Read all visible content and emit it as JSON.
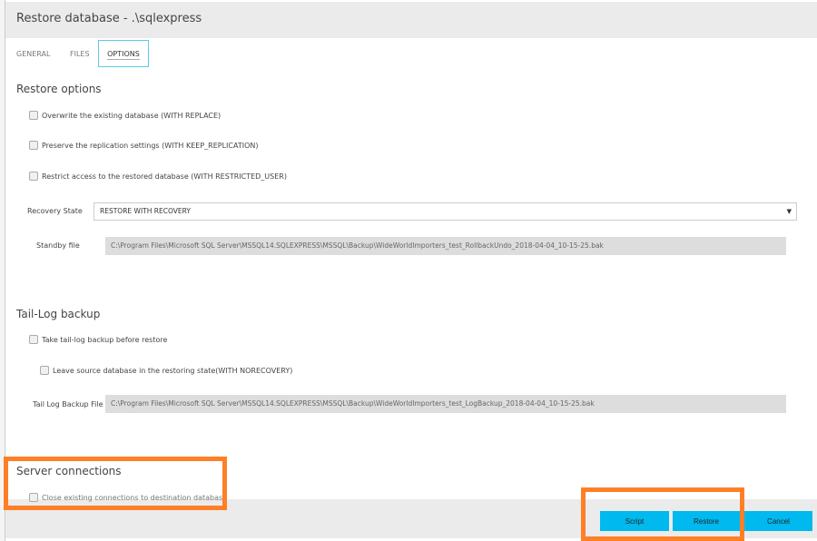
{
  "title": "Restore database - .\\sqlexpress",
  "tabs": [
    "GENERAL",
    "FILES",
    "OPTIONS"
  ],
  "restore_options": {
    "heading": "Restore options",
    "checkboxes": [
      "Overwrite the existing database (WITH REPLACE)",
      "Preserve the replication settings (WITH KEEP_REPLICATION)",
      "Restrict access to the restored database (WITH RESTRICTED_USER)"
    ],
    "recovery_state_label": "Recovery State",
    "recovery_state_value": "RESTORE WITH RECOVERY",
    "standby_label": "Standby file",
    "standby_value": "C:\\Program Files\\Microsoft SQL Server\\MSSQL14.SQLEXPRESS\\MSSQL\\Backup\\WideWorldImporters_test_RollbackUndo_2018-04-04_10-15-25.bak"
  },
  "tail_log": {
    "heading": "Tail-Log backup",
    "take_backup": "Take tail-log backup before restore",
    "leave_source": "Leave source database in the restoring state(WITH NORECOVERY)",
    "file_label": "Tail Log Backup File",
    "file_value": "C:\\Program Files\\Microsoft SQL Server\\MSSQL14.SQLEXPRESS\\MSSQL\\Backup\\WideWorldImporters_test_LogBackup_2018-04-04_10-15-25.bak"
  },
  "server_connections": {
    "heading": "Server connections",
    "close_existing": "Close existing connections to destination database"
  },
  "buttons": {
    "script": "Script",
    "restore": "Restore",
    "cancel": "Cancel"
  },
  "colors": {
    "accent": "#00b9ee",
    "highlight": "#ff7f27"
  }
}
